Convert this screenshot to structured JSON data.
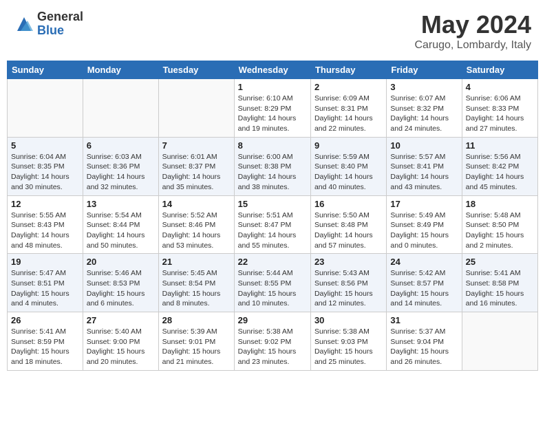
{
  "header": {
    "logo_general": "General",
    "logo_blue": "Blue",
    "month_title": "May 2024",
    "location": "Carugo, Lombardy, Italy"
  },
  "days_of_week": [
    "Sunday",
    "Monday",
    "Tuesday",
    "Wednesday",
    "Thursday",
    "Friday",
    "Saturday"
  ],
  "weeks": [
    [
      {
        "day": "",
        "info": ""
      },
      {
        "day": "",
        "info": ""
      },
      {
        "day": "",
        "info": ""
      },
      {
        "day": "1",
        "info": "Sunrise: 6:10 AM\nSunset: 8:29 PM\nDaylight: 14 hours\nand 19 minutes."
      },
      {
        "day": "2",
        "info": "Sunrise: 6:09 AM\nSunset: 8:31 PM\nDaylight: 14 hours\nand 22 minutes."
      },
      {
        "day": "3",
        "info": "Sunrise: 6:07 AM\nSunset: 8:32 PM\nDaylight: 14 hours\nand 24 minutes."
      },
      {
        "day": "4",
        "info": "Sunrise: 6:06 AM\nSunset: 8:33 PM\nDaylight: 14 hours\nand 27 minutes."
      }
    ],
    [
      {
        "day": "5",
        "info": "Sunrise: 6:04 AM\nSunset: 8:35 PM\nDaylight: 14 hours\nand 30 minutes."
      },
      {
        "day": "6",
        "info": "Sunrise: 6:03 AM\nSunset: 8:36 PM\nDaylight: 14 hours\nand 32 minutes."
      },
      {
        "day": "7",
        "info": "Sunrise: 6:01 AM\nSunset: 8:37 PM\nDaylight: 14 hours\nand 35 minutes."
      },
      {
        "day": "8",
        "info": "Sunrise: 6:00 AM\nSunset: 8:38 PM\nDaylight: 14 hours\nand 38 minutes."
      },
      {
        "day": "9",
        "info": "Sunrise: 5:59 AM\nSunset: 8:40 PM\nDaylight: 14 hours\nand 40 minutes."
      },
      {
        "day": "10",
        "info": "Sunrise: 5:57 AM\nSunset: 8:41 PM\nDaylight: 14 hours\nand 43 minutes."
      },
      {
        "day": "11",
        "info": "Sunrise: 5:56 AM\nSunset: 8:42 PM\nDaylight: 14 hours\nand 45 minutes."
      }
    ],
    [
      {
        "day": "12",
        "info": "Sunrise: 5:55 AM\nSunset: 8:43 PM\nDaylight: 14 hours\nand 48 minutes."
      },
      {
        "day": "13",
        "info": "Sunrise: 5:54 AM\nSunset: 8:44 PM\nDaylight: 14 hours\nand 50 minutes."
      },
      {
        "day": "14",
        "info": "Sunrise: 5:52 AM\nSunset: 8:46 PM\nDaylight: 14 hours\nand 53 minutes."
      },
      {
        "day": "15",
        "info": "Sunrise: 5:51 AM\nSunset: 8:47 PM\nDaylight: 14 hours\nand 55 minutes."
      },
      {
        "day": "16",
        "info": "Sunrise: 5:50 AM\nSunset: 8:48 PM\nDaylight: 14 hours\nand 57 minutes."
      },
      {
        "day": "17",
        "info": "Sunrise: 5:49 AM\nSunset: 8:49 PM\nDaylight: 15 hours\nand 0 minutes."
      },
      {
        "day": "18",
        "info": "Sunrise: 5:48 AM\nSunset: 8:50 PM\nDaylight: 15 hours\nand 2 minutes."
      }
    ],
    [
      {
        "day": "19",
        "info": "Sunrise: 5:47 AM\nSunset: 8:51 PM\nDaylight: 15 hours\nand 4 minutes."
      },
      {
        "day": "20",
        "info": "Sunrise: 5:46 AM\nSunset: 8:53 PM\nDaylight: 15 hours\nand 6 minutes."
      },
      {
        "day": "21",
        "info": "Sunrise: 5:45 AM\nSunset: 8:54 PM\nDaylight: 15 hours\nand 8 minutes."
      },
      {
        "day": "22",
        "info": "Sunrise: 5:44 AM\nSunset: 8:55 PM\nDaylight: 15 hours\nand 10 minutes."
      },
      {
        "day": "23",
        "info": "Sunrise: 5:43 AM\nSunset: 8:56 PM\nDaylight: 15 hours\nand 12 minutes."
      },
      {
        "day": "24",
        "info": "Sunrise: 5:42 AM\nSunset: 8:57 PM\nDaylight: 15 hours\nand 14 minutes."
      },
      {
        "day": "25",
        "info": "Sunrise: 5:41 AM\nSunset: 8:58 PM\nDaylight: 15 hours\nand 16 minutes."
      }
    ],
    [
      {
        "day": "26",
        "info": "Sunrise: 5:41 AM\nSunset: 8:59 PM\nDaylight: 15 hours\nand 18 minutes."
      },
      {
        "day": "27",
        "info": "Sunrise: 5:40 AM\nSunset: 9:00 PM\nDaylight: 15 hours\nand 20 minutes."
      },
      {
        "day": "28",
        "info": "Sunrise: 5:39 AM\nSunset: 9:01 PM\nDaylight: 15 hours\nand 21 minutes."
      },
      {
        "day": "29",
        "info": "Sunrise: 5:38 AM\nSunset: 9:02 PM\nDaylight: 15 hours\nand 23 minutes."
      },
      {
        "day": "30",
        "info": "Sunrise: 5:38 AM\nSunset: 9:03 PM\nDaylight: 15 hours\nand 25 minutes."
      },
      {
        "day": "31",
        "info": "Sunrise: 5:37 AM\nSunset: 9:04 PM\nDaylight: 15 hours\nand 26 minutes."
      },
      {
        "day": "",
        "info": ""
      }
    ]
  ]
}
